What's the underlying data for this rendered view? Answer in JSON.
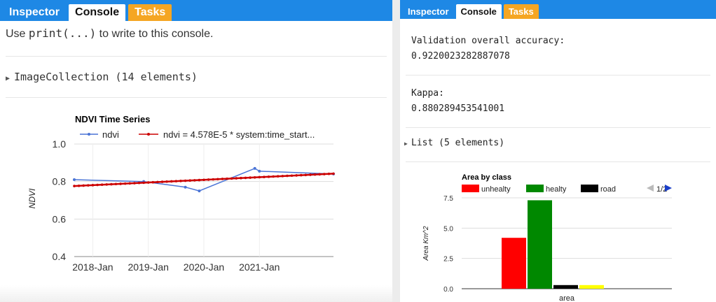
{
  "tabs": {
    "inspector": "Inspector",
    "console": "Console",
    "tasks": "Tasks"
  },
  "left": {
    "hint_prefix": "Use ",
    "hint_code": "print(...)",
    "hint_suffix": " to write to this console.",
    "collection": "ImageCollection (14 elements)"
  },
  "right": {
    "accuracy_label": "Validation overall accuracy:",
    "accuracy_value": "0.9220023282887078",
    "kappa_label": "Kappa:",
    "kappa_value": "0.880289453541001",
    "list": "List (5 elements)"
  },
  "colors": {
    "tab_blue": "#1e88e5",
    "tasks_orange": "#f5a623"
  },
  "chart_data": [
    {
      "type": "line",
      "title": "NDVI Time Series",
      "xlabel": "",
      "ylabel": "NDVI",
      "ylim": [
        0.4,
        1.0
      ],
      "yticks": [
        "1.0",
        "0.8",
        "0.6",
        "0.4"
      ],
      "xticks": [
        "2018-Jan",
        "2019-Jan",
        "2020-Jan",
        "2021-Jan"
      ],
      "x_range": [
        "2017-09",
        "2022-05"
      ],
      "legend": "top",
      "series": [
        {
          "name": "ndvi",
          "color": "#4a74d6",
          "x": [
            "2017-09",
            "2018-12",
            "2019-09",
            "2019-12",
            "2020-12",
            "2021-01",
            "2022-05"
          ],
          "values": [
            0.81,
            0.8,
            0.77,
            0.75,
            0.87,
            0.855,
            0.84
          ]
        },
        {
          "name": "ndvi = 4.578E-5 * system:time_start...",
          "color": "#cc0000",
          "x": [
            "2017-09",
            "2022-05"
          ],
          "values": [
            0.776,
            0.842
          ]
        }
      ]
    },
    {
      "type": "bar",
      "title": "Area by class",
      "xlabel": "area",
      "ylabel": "Area Km^2",
      "ylim": [
        0,
        7.5
      ],
      "yticks": [
        "7.5",
        "5.0",
        "2.5",
        "0.0"
      ],
      "legend": "top",
      "legend_pager": "1/2",
      "categories": [
        "area"
      ],
      "series": [
        {
          "name": "unhealty",
          "color": "#ff0000",
          "values": [
            4.2
          ]
        },
        {
          "name": "healty",
          "color": "#008800",
          "values": [
            7.3
          ]
        },
        {
          "name": "road",
          "color": "#000000",
          "values": [
            0.3
          ]
        },
        {
          "name": "",
          "color": "#ffff00",
          "values": [
            0.3
          ]
        }
      ]
    }
  ]
}
